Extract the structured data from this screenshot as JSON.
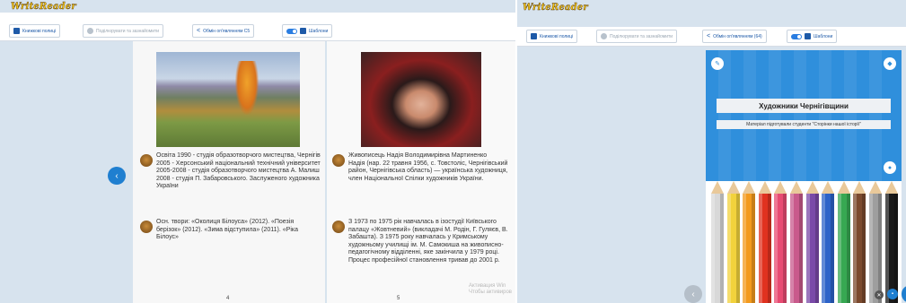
{
  "app": {
    "logo": "WriteReader"
  },
  "toolbar": {
    "library_label": "Книжкові полиці",
    "share_label": "Поділюрувати та зазнайомити",
    "publish_label": "Обмін оп'являнням C5",
    "templates_label": "Шаблони"
  },
  "toolbar_right": {
    "library_label": "Книжкові полиці",
    "share_label": "Поділюрувати та зазнайомити",
    "publish_label": "Обмін оп'являнням (64)",
    "templates_label": "Шаблони"
  },
  "book": {
    "left_page": {
      "number": "4",
      "para1": "Освіта 1990 - студія образотворчого мистецтва, Чернігів 2005 - Херсонський національний технічний університет 2005-2008 - студія образотворчого мистецтва А. Малиш 2008 - студія П. Забаровського. Заслуженого художника України",
      "para2": "Осн. твори: «Околиця Білоуса» (2012). «Поезія берізок» (2012). «Зима відступила» (2011). «Ріка Білоус»"
    },
    "right_page": {
      "number": "5",
      "para1": "Живописець Надія Володимирівна Мартиненко",
      "para1b": "Надія (нар. 22 травня 1956, с. Товстоліс, Чернігівський район, Чернігівська область) — українська художниця, член Національної Спілки художників України.",
      "para2": "З 1973 по 1975 рік навчалась в ізостудії Київського палацу «Жовтневий» (викладачі М. Родін, Г. Гуляєв, В. Забашта). З 1975 року навчалась у Кримському художньому училищі ім. М. Самокиша на живописно-педагогічному відділенні, яке закінчила у 1979 році. Процес професійної становлення тривав до 2001 р."
    },
    "watermark": "Активация Win\nЧтобы активиров"
  },
  "cover": {
    "title": "Художники Чернігівщини",
    "subtitle": "Матеріал підготували студенти \"Сторінки нашої історії\""
  },
  "icons": {
    "nav_left": "chevron-left-icon",
    "nav_right": "chevron-right-icon"
  },
  "colors": {
    "accent": "#1f7fd0",
    "cover_bg": "#2f8fdc",
    "pencils": [
      "#d8d8d8",
      "#f2d23c",
      "#f39a1e",
      "#e0321f",
      "#e84b72",
      "#c95a8c",
      "#7a4aa8",
      "#2d63c8",
      "#37a852",
      "#7b4a2e",
      "#9e9e9e",
      "#1a1a1a"
    ]
  }
}
